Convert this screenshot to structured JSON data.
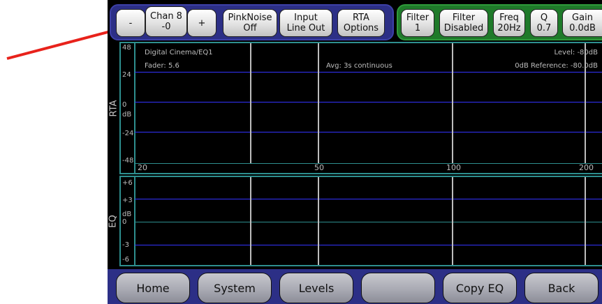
{
  "top_buttons": {
    "minus": "-",
    "chan_line1": "Chan 8",
    "chan_line2": "-0",
    "plus": "+",
    "pinknoise_line1": "PinkNoise",
    "pinknoise_line2": "Off",
    "input_line1": "Input",
    "input_line2": "Line Out",
    "rta_line1": "RTA",
    "rta_line2": "Options",
    "filter_line1": "Filter",
    "filter_line2": "1",
    "filterstate_line1": "Filter",
    "filterstate_line2": "Disabled",
    "freq_line1": "Freq",
    "freq_line2": "20Hz",
    "q_line1": "Q",
    "q_line2": "0.7",
    "gain_line1": "Gain",
    "gain_line2": "0.0dB"
  },
  "rta": {
    "side_label": "RTA",
    "unit": "dB",
    "ticks": [
      "48",
      "24",
      "0",
      "-24",
      "-48"
    ],
    "preset": "Digital Cinema/EQ1",
    "fader": "Fader: 5.6",
    "avg": "Avg: 3s continuous",
    "level": "Level: -80dB",
    "reference": "0dB Reference: -80.0dB",
    "x_ticks": [
      "20",
      "50",
      "100",
      "200"
    ]
  },
  "eq": {
    "side_label": "EQ",
    "unit": "dB",
    "ticks": [
      "+6",
      "+3",
      "0",
      "-3",
      "-6"
    ]
  },
  "bottom_buttons": {
    "home": "Home",
    "system": "System",
    "levels": "Levels",
    "blank": "",
    "copy_eq": "Copy EQ",
    "back": "Back"
  },
  "colors": {
    "top_group_blue": "#2c2f86",
    "top_group_green": "#1f7a2a",
    "grid_blue": "#3333ff",
    "panel_border": "#2e8f8f",
    "annotation_arrow": "#e8221b"
  }
}
